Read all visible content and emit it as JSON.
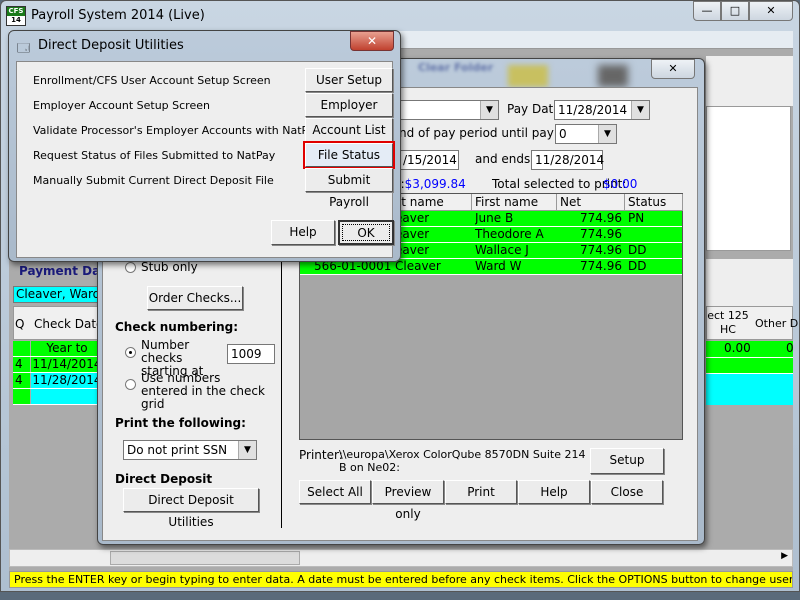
{
  "main_window": {
    "title": "Payroll System 2014 (Live)",
    "logo_text": [
      "CFS",
      "14"
    ],
    "controls": {
      "minimize": "—",
      "maximize": "□",
      "close": "✕"
    }
  },
  "payment_panel": {
    "title": "Payment Data",
    "employee": "Cleaver, Ward",
    "headers": [
      "Q",
      "Check Date"
    ],
    "rows": [
      {
        "q": "",
        "date": "Year to Date"
      },
      {
        "q": "4",
        "date": "11/14/2014"
      },
      {
        "q": "4",
        "date": "11/28/2014"
      },
      {
        "q": "",
        "date": ""
      }
    ],
    "right_headers": [
      "ect 125 HC",
      "Other D"
    ],
    "right_values": [
      "0.00",
      "0"
    ]
  },
  "print_dialog": {
    "toolbar_blurred": [
      "Clear Folder"
    ],
    "pay_date_label": "Pay Date:",
    "pay_date": "11/28/2014",
    "period_label": "nd of pay period until pay date:",
    "period_value": "0",
    "start_date": "/15/2014",
    "ends_label": "and ends",
    "end_date": "11/28/2014",
    "total_label": "d:",
    "total": "$3,099.84",
    "selected_label": "Total selected to print:",
    "selected": "$0.00",
    "grid_headers": [
      "st name",
      "First name",
      "Net",
      "Status"
    ],
    "grid_rows": [
      {
        "ssn": "",
        "last": "eaver",
        "first": "June B",
        "net": "774.96",
        "status": "PN"
      },
      {
        "ssn": "",
        "last": "eaver",
        "first": "Theodore A",
        "net": "774.96",
        "status": ""
      },
      {
        "ssn": "",
        "last": "eaver",
        "first": "Wallace J",
        "net": "774.96",
        "status": "DD"
      },
      {
        "ssn": "566-01-0001",
        "last": "Cleaver",
        "first": "Ward W",
        "net": "774.96",
        "status": "DD"
      }
    ],
    "stub_only": "Stub only",
    "order_checks": "Order Checks...",
    "check_numbering": "Check numbering:",
    "number_checks": "Number checks starting at",
    "start_number": "1009",
    "use_numbers": "Use numbers entered in the check grid",
    "print_following": "Print the following:",
    "ssn_option": "Do not print SSN",
    "direct_deposit": "Direct Deposit",
    "dd_utilities": "Direct Deposit Utilities",
    "printer_label": "Printer:",
    "printer_name": "\\\\europa\\Xerox ColorQube 8570DN Suite 214 B on Ne02:",
    "setup": "Setup",
    "buttons": [
      "Select All",
      "Preview only",
      "Print",
      "Help",
      "Close"
    ],
    "close_x": "✕"
  },
  "dd_dialog": {
    "title": "Direct Deposit Utilities",
    "close": "✕",
    "items": [
      {
        "label": "Enrollment/CFS User Account Setup Screen",
        "button": "User Setup"
      },
      {
        "label": "Employer Account Setup Screen",
        "button": "Employer Setup"
      },
      {
        "label": "Validate Processor's Employer Accounts with NatPay",
        "button": "Account List"
      },
      {
        "label": "Request Status of Files Submitted to NatPay",
        "button": "File Status"
      },
      {
        "label": "Manually Submit Current Direct Deposit File",
        "button": "Submit Payroll"
      }
    ],
    "help": "Help",
    "ok": "OK",
    "highlight_color": "#e00000"
  },
  "status_bar": {
    "text": "Press the ENTER key or begin typing to enter data.  A date must be entered before any check items.  Click the OPTIONS button to change user settings.",
    "color": "#ffff00"
  },
  "colors": {
    "green": "#00ff00",
    "cyan": "#00ffff",
    "link_blue": "#0000ff"
  }
}
